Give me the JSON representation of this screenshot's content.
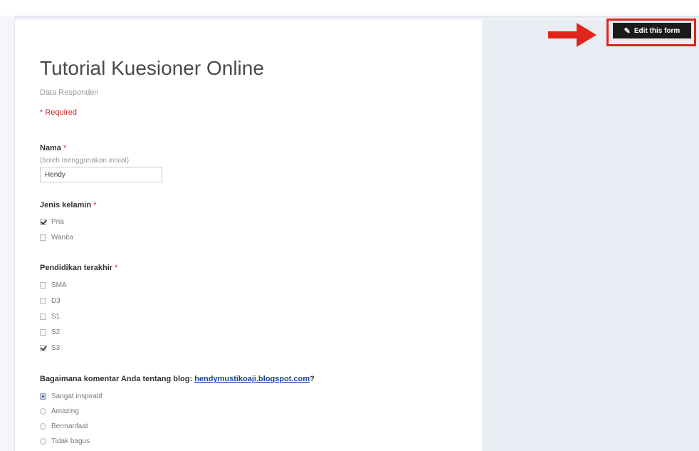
{
  "form": {
    "title": "Tutorial Kuesioner Online",
    "description": "Data Responden",
    "required_note": "* Required"
  },
  "edit_button": {
    "label": "Edit this form",
    "icon": "pencil-icon",
    "highlight_color": "#e0251b"
  },
  "questions": {
    "nama": {
      "label": "Nama",
      "required_mark": "*",
      "help": "(boleh menggunakan inisial)",
      "value": "Hendy"
    },
    "jenis_kelamin": {
      "label": "Jenis kelamin",
      "required_mark": "*",
      "options": [
        {
          "label": "Pria",
          "checked": true
        },
        {
          "label": "Wanita",
          "checked": false
        }
      ]
    },
    "pendidikan": {
      "label": "Pendidikan terakhir",
      "required_mark": "*",
      "options": [
        {
          "label": "SMA",
          "checked": false
        },
        {
          "label": "D3",
          "checked": false
        },
        {
          "label": "S1",
          "checked": false
        },
        {
          "label": "S2",
          "checked": false
        },
        {
          "label": "S3",
          "checked": true
        }
      ]
    },
    "komentar": {
      "label_prefix": "Bagaimana komentar Anda tentang blog:",
      "link_text": "hendymustikoaji.blogspot.com",
      "label_suffix": "?",
      "options": [
        {
          "label": "Sangat inspiratif",
          "selected": true
        },
        {
          "label": "Amazing",
          "selected": false
        },
        {
          "label": "Bermanfaat",
          "selected": false
        },
        {
          "label": "Tidak bagus",
          "selected": false
        }
      ]
    }
  }
}
